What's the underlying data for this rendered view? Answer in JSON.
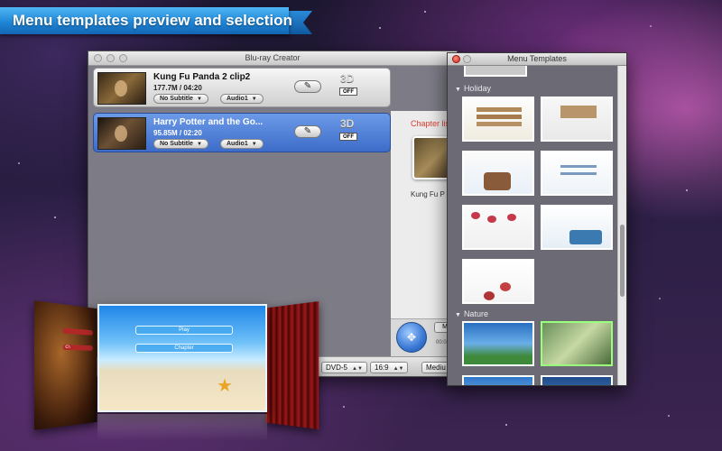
{
  "banner": {
    "text": "Menu templates preview and selection"
  },
  "main_window": {
    "title": "Blu-ray Creator",
    "files": [
      {
        "title": "Kung Fu Panda 2 clip2",
        "meta": "177.7M / 04:20",
        "subtitle": "No Subtitle",
        "audio": "Audio1",
        "three_d": "3D",
        "three_d_state": "OFF",
        "selected": false
      },
      {
        "title": "Harry Potter and the Go...",
        "meta": "95.85M / 02:20",
        "subtitle": "No Subtitle",
        "audio": "Audio1",
        "three_d": "3D",
        "three_d_state": "OFF",
        "selected": true
      }
    ],
    "chapter_panel": {
      "title": "Chapter lis",
      "item_label": "Kung Fu P"
    },
    "bottom_panel": {
      "small_button": "M",
      "time": "00:0"
    },
    "status_bar": {
      "disc_type": "DVD-5",
      "aspect": "16:9",
      "quality": "Mediu"
    }
  },
  "templates_window": {
    "title": "Menu Templates",
    "categories": [
      {
        "label": "Holiday"
      },
      {
        "label": "Nature"
      }
    ]
  },
  "carousel": {
    "center": {
      "play_label": "Play",
      "chapter_label": "Chapter"
    },
    "left": {
      "bar_label": "Ch"
    }
  },
  "icons": {
    "edit": "pencil-icon",
    "nav": "navigation-arrows-icon",
    "dropdown": "triangle-down-icon",
    "disclosure": "triangle-down-icon"
  },
  "colors": {
    "banner": "#1f86d6",
    "selection": "#3d6cc9",
    "chapter_title": "#e23a2c",
    "close_button": "#d62c1e"
  }
}
